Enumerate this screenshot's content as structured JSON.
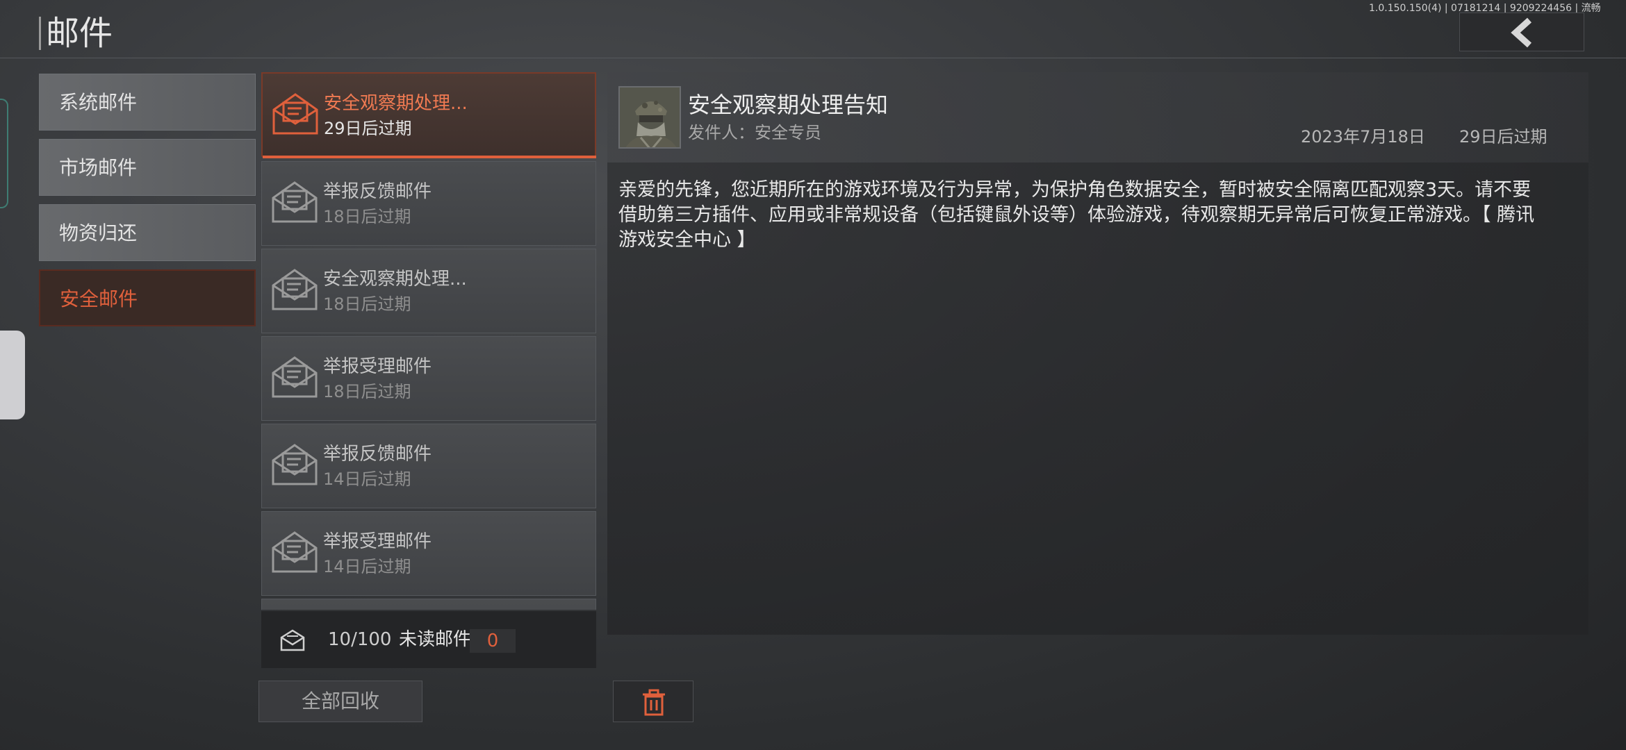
{
  "header": {
    "title": "邮件",
    "version": "1.0.150.150(4) | 07181214 | 9209224456 | 流畅",
    "back_icon": "chevron-left-icon"
  },
  "categories": [
    {
      "label": "系统邮件",
      "selected": false
    },
    {
      "label": "市场邮件",
      "selected": false
    },
    {
      "label": "物资归还",
      "selected": false
    },
    {
      "label": "安全邮件",
      "selected": true
    }
  ],
  "mail_list": [
    {
      "subject": "安全观察期处理...",
      "expiry": "29日后过期",
      "selected": true
    },
    {
      "subject": "举报反馈邮件",
      "expiry": "18日后过期",
      "selected": false
    },
    {
      "subject": "安全观察期处理...",
      "expiry": "18日后过期",
      "selected": false
    },
    {
      "subject": "举报受理邮件",
      "expiry": "18日后过期",
      "selected": false
    },
    {
      "subject": "举报反馈邮件",
      "expiry": "14日后过期",
      "selected": false
    },
    {
      "subject": "举报受理邮件",
      "expiry": "14日后过期",
      "selected": false
    }
  ],
  "footer": {
    "count": "10/100",
    "unread_label": "未读邮件",
    "unread_count": "0",
    "collect_all_label": "全部回收"
  },
  "detail": {
    "title": "安全观察期处理告知",
    "sender": "发件人：安全专员",
    "date": "2023年7月18日",
    "expiry": "29日后过期",
    "body": "亲爱的先锋，您近期所在的游戏环境及行为异常，为保护角色数据安全，暂时被安全隔离匹配观察3天。请不要借助第三方插件、应用或非常规设备（包括键鼠外设等）体验游戏，待观察期无异常后可恢复正常游戏。【 腾讯游戏安全中心 】",
    "delete_icon": "trash-icon"
  },
  "colors": {
    "accent": "#e0603c",
    "background": "#3a3c3f",
    "panel": "#262729"
  }
}
